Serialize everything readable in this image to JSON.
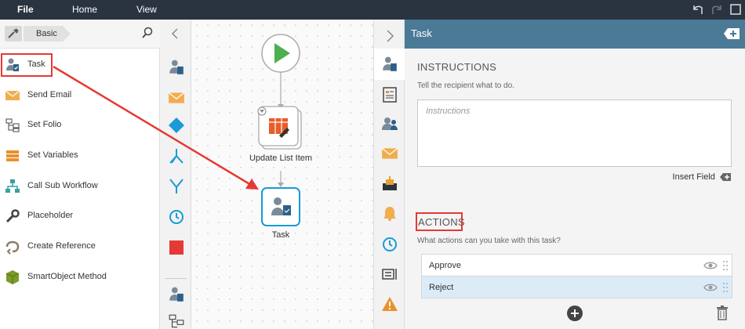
{
  "menu": {
    "file": "File",
    "home": "Home",
    "view": "View"
  },
  "toolbox": {
    "breadcrumb": "Basic",
    "items": [
      {
        "label": "Task",
        "icon": "task-icon"
      },
      {
        "label": "Send Email",
        "icon": "email-icon"
      },
      {
        "label": "Set Folio",
        "icon": "folio-icon"
      },
      {
        "label": "Set Variables",
        "icon": "variables-icon"
      },
      {
        "label": "Call Sub Workflow",
        "icon": "sub-workflow-icon"
      },
      {
        "label": "Placeholder",
        "icon": "wrench-icon"
      },
      {
        "label": "Create Reference",
        "icon": "reference-icon"
      },
      {
        "label": "SmartObject Method",
        "icon": "smartobject-icon"
      }
    ]
  },
  "canvas": {
    "nodes": [
      {
        "label": "Update List Item"
      },
      {
        "label": "Task"
      }
    ]
  },
  "properties": {
    "title": "Task",
    "instructions_heading": "INSTRUCTIONS",
    "instructions_help": "Tell the recipient what to do.",
    "instructions_placeholder": "Instructions",
    "insert_field": "Insert Field",
    "actions_heading": "ACTIONS",
    "actions_help": "What actions can you take with this task?",
    "actions": [
      {
        "label": "Approve",
        "selected": false
      },
      {
        "label": "Reject",
        "selected": true
      }
    ]
  },
  "colors": {
    "menubar": "#2a3440",
    "panel_header": "#4a7a96",
    "highlight": "#e53935",
    "start": "#4caf50",
    "accent": "#1a9ad6"
  }
}
